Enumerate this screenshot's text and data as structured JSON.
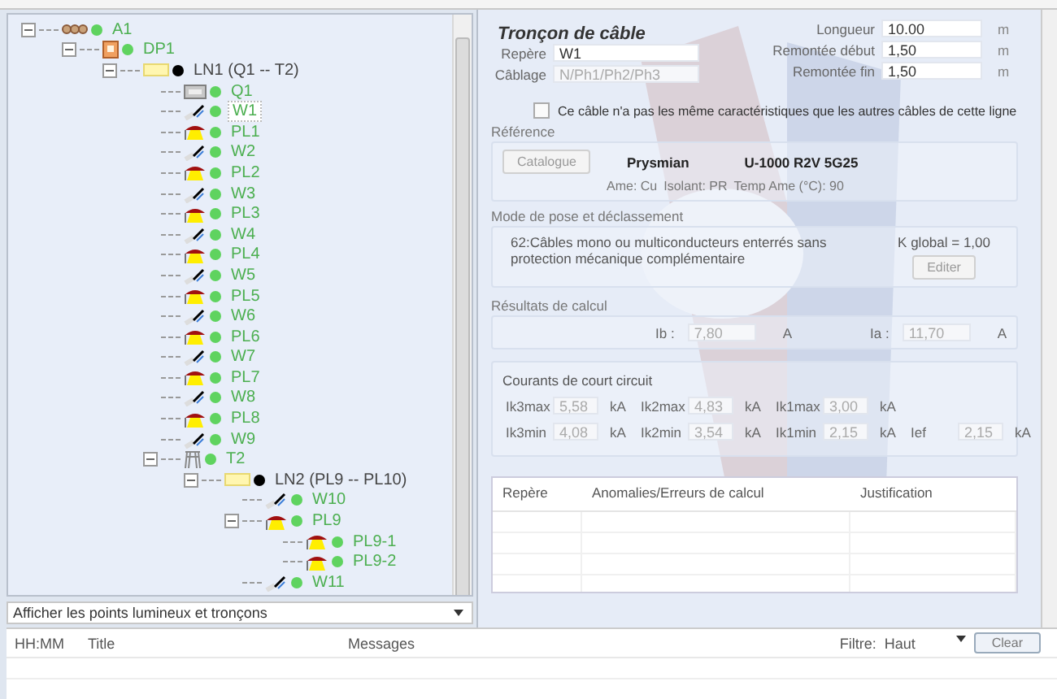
{
  "tree": {
    "items": [
      {
        "label": "A1",
        "kind": "cabinet",
        "color": "#5fd35f",
        "expanded": true,
        "selected": false,
        "children": [
          {
            "label": "DP1",
            "kind": "board",
            "color": "#5fd35f",
            "expanded": true,
            "selected": false,
            "children": [
              {
                "label": "LN1 (Q1 -- T2)",
                "kind": "line",
                "color": "#000000",
                "expanded": true,
                "selected": false,
                "children": [
                  {
                    "label": "Q1",
                    "kind": "breaker",
                    "color": "#5fd35f",
                    "selected": false
                  },
                  {
                    "label": "W1",
                    "kind": "cable",
                    "color": "#5fd35f",
                    "selected": true
                  },
                  {
                    "label": "PL1",
                    "kind": "light",
                    "color": "#5fd35f",
                    "selected": false
                  },
                  {
                    "label": "W2",
                    "kind": "cable",
                    "color": "#5fd35f",
                    "selected": false
                  },
                  {
                    "label": "PL2",
                    "kind": "light",
                    "color": "#5fd35f",
                    "selected": false
                  },
                  {
                    "label": "W3",
                    "kind": "cable",
                    "color": "#5fd35f",
                    "selected": false
                  },
                  {
                    "label": "PL3",
                    "kind": "light",
                    "color": "#5fd35f",
                    "selected": false
                  },
                  {
                    "label": "W4",
                    "kind": "cable",
                    "color": "#5fd35f",
                    "selected": false
                  },
                  {
                    "label": "PL4",
                    "kind": "light",
                    "color": "#5fd35f",
                    "selected": false
                  },
                  {
                    "label": "W5",
                    "kind": "cable",
                    "color": "#5fd35f",
                    "selected": false
                  },
                  {
                    "label": "PL5",
                    "kind": "light",
                    "color": "#5fd35f",
                    "selected": false
                  },
                  {
                    "label": "W6",
                    "kind": "cable",
                    "color": "#5fd35f",
                    "selected": false
                  },
                  {
                    "label": "PL6",
                    "kind": "light",
                    "color": "#5fd35f",
                    "selected": false
                  },
                  {
                    "label": "W7",
                    "kind": "cable",
                    "color": "#5fd35f",
                    "selected": false
                  },
                  {
                    "label": "PL7",
                    "kind": "light",
                    "color": "#5fd35f",
                    "selected": false
                  },
                  {
                    "label": "W8",
                    "kind": "cable",
                    "color": "#5fd35f",
                    "selected": false
                  },
                  {
                    "label": "PL8",
                    "kind": "light",
                    "color": "#5fd35f",
                    "selected": false
                  },
                  {
                    "label": "W9",
                    "kind": "cable",
                    "color": "#5fd35f",
                    "selected": false
                  },
                  {
                    "label": "T2",
                    "kind": "transformer",
                    "color": "#5fd35f",
                    "expanded": true,
                    "selected": false,
                    "children": [
                      {
                        "label": "LN2 (PL9 -- PL10)",
                        "kind": "line",
                        "color": "#000000",
                        "expanded": true,
                        "selected": false,
                        "children": [
                          {
                            "label": "W10",
                            "kind": "cable",
                            "color": "#5fd35f",
                            "selected": false
                          },
                          {
                            "label": "PL9",
                            "kind": "light",
                            "color": "#5fd35f",
                            "expanded": true,
                            "selected": false,
                            "children": [
                              {
                                "label": "PL9-1",
                                "kind": "light",
                                "color": "#5fd35f",
                                "selected": false
                              },
                              {
                                "label": "PL9-2",
                                "kind": "light",
                                "color": "#5fd35f",
                                "selected": false
                              }
                            ]
                          },
                          {
                            "label": "W11",
                            "kind": "cable",
                            "color": "#5fd35f",
                            "selected": false
                          }
                        ]
                      }
                    ]
                  }
                ]
              }
            ]
          }
        ]
      }
    ]
  },
  "tree_filter": {
    "value": "Afficher les points lumineux et tronçons"
  },
  "form": {
    "title": "Tronçon de câble",
    "repere": {
      "label": "Repère",
      "value": "W1",
      "disabled": false
    },
    "cablage": {
      "label": "Câblage",
      "value": "N/Ph1/Ph2/Ph3",
      "disabled": true
    },
    "lengths": [
      {
        "label": "Longueur",
        "value": "10.00",
        "unit": "m"
      },
      {
        "label": "Remontée début",
        "value": "1,50",
        "unit": "m"
      },
      {
        "label": "Remontée fin",
        "value": "1,50",
        "unit": "m"
      }
    ],
    "different_checkbox": {
      "label": "Ce câble n'a pas les même caractéristiques que les autres câbles de cette ligne",
      "checked": false
    },
    "reference": {
      "title": "Référence",
      "button": "Catalogue",
      "maker": "Prysmian",
      "model": "U-1000 R2V 5G25",
      "specs": [
        "Ame: Cu",
        "Isolant: PR",
        "Temp Ame (°C): 90"
      ]
    },
    "mode_pose": {
      "title": "Mode de pose et déclassement",
      "description": "62:Câbles mono ou multiconducteurs enterrés sans protection mécanique complémentaire",
      "kglobal": "K global = 1,00",
      "button": "Editer"
    },
    "results": {
      "title": "Résultats de calcul",
      "disabled": true,
      "values": [
        {
          "label": "Ib :",
          "value": "7,80",
          "unit": "A"
        },
        {
          "label": "Ia :",
          "value": "11,70",
          "unit": "A"
        }
      ]
    },
    "short_circuit": {
      "title": "Courants de court circuit",
      "disabled": true,
      "rows": [
        [
          {
            "label": "Ik3max",
            "value": "5,58",
            "unit": "kA"
          },
          {
            "label": "Ik2max",
            "value": "4,83",
            "unit": "kA"
          },
          {
            "label": "Ik1max",
            "value": "3,00",
            "unit": "kA"
          }
        ],
        [
          {
            "label": "Ik3min",
            "value": "4,08",
            "unit": "kA"
          },
          {
            "label": "Ik2min",
            "value": "3,54",
            "unit": "kA"
          },
          {
            "label": "Ik1min",
            "value": "2,15",
            "unit": "kA"
          },
          {
            "label": "Ief",
            "value": "2,15",
            "unit": "kA"
          }
        ]
      ]
    },
    "errors_table": {
      "columns": [
        "Repère",
        "Anomalies/Erreurs de calcul",
        "Justification"
      ]
    }
  },
  "log": {
    "columns": [
      "HH:MM",
      "Title",
      "Messages"
    ],
    "filter_label": "Filtre:",
    "filter_value": "Haut",
    "clear_button": "Clear"
  }
}
